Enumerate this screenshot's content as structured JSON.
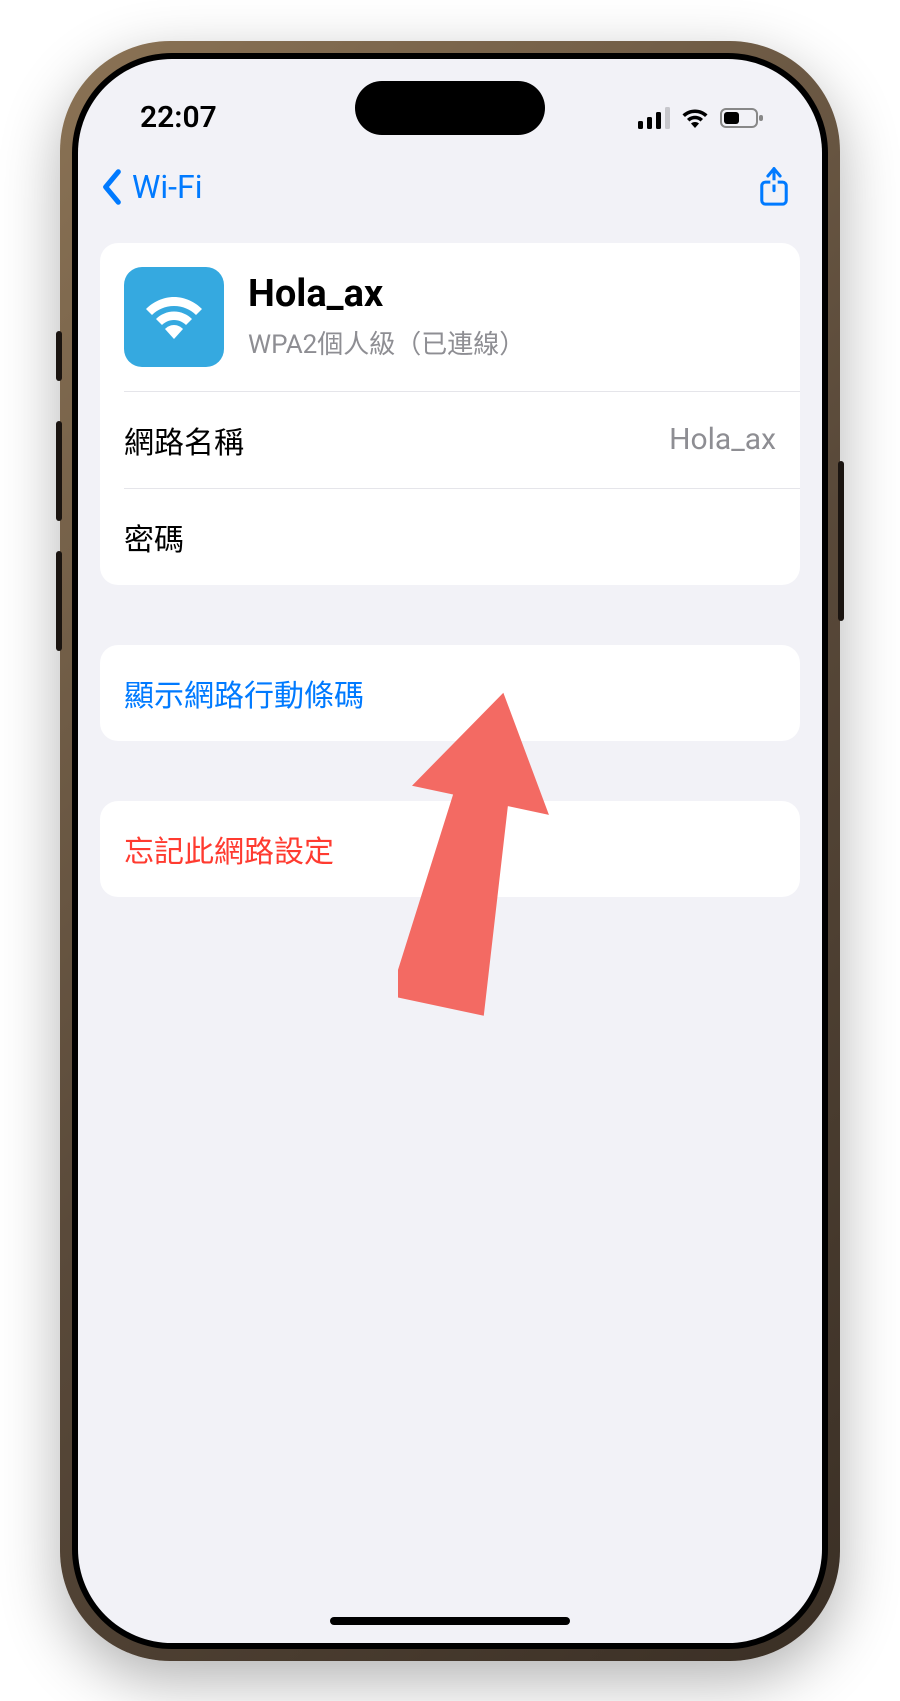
{
  "status_bar": {
    "time": "22:07"
  },
  "nav": {
    "back_label": "Wi-Fi"
  },
  "network": {
    "name": "Hola_ax",
    "subtitle": "WPA2個人級（已連線）",
    "rows": {
      "name_label": "網路名稱",
      "name_value": "Hola_ax",
      "password_label": "密碼"
    }
  },
  "actions": {
    "show_qr": "顯示網路行動條碼",
    "forget": "忘記此網路設定"
  }
}
